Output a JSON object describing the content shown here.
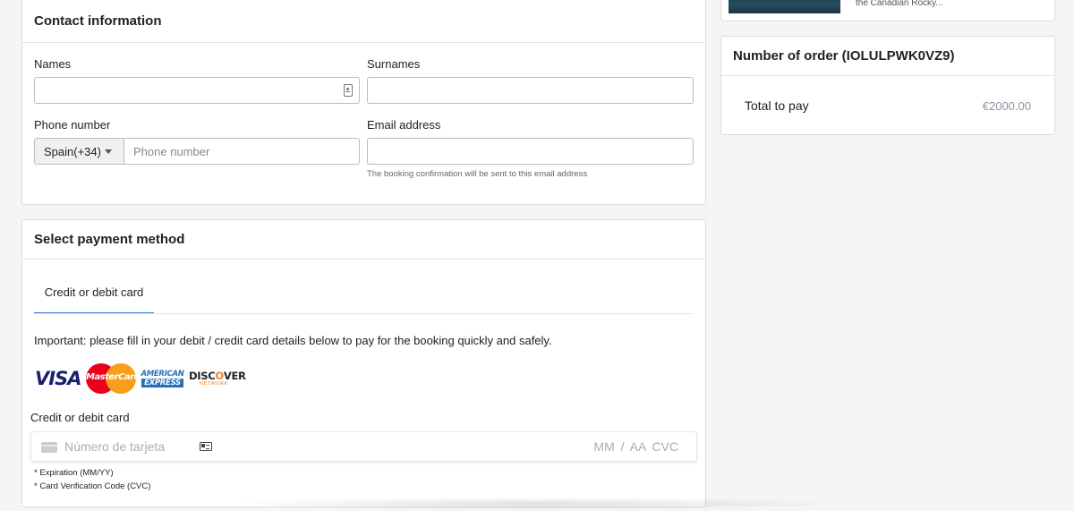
{
  "contact": {
    "title": "Contact information",
    "names_label": "Names",
    "names_value": "",
    "surnames_label": "Surnames",
    "surnames_value": "",
    "phone_label": "Phone number",
    "country_code": "Spain(+34)",
    "phone_placeholder": "Phone number",
    "email_label": "Email address",
    "email_value": "",
    "email_help": "The booking confirmation will be sent to this email address"
  },
  "payment": {
    "title": "Select payment method",
    "tab_label": "Credit or debit card",
    "notice": "Important: please fill in your debit / credit card details below to pay for the booking quickly and safely.",
    "logos": {
      "visa": "VISA",
      "mastercard": "MasterCard",
      "amex_line1": "AMERICAN",
      "amex_line2": "EXPRESS",
      "discover_line1a": "DISC",
      "discover_line1b": "O",
      "discover_line1c": "VER",
      "discover_line2": "NETWORK"
    },
    "card_label": "Credit or debit card",
    "card_number_placeholder": "Número de tarjeta",
    "expiry_cvc_placeholder": "MM / AA  CVC",
    "footnote_1": "* Expiration (MM/YY)",
    "footnote_2": "* Card Verification Code (CVC)"
  },
  "trip": {
    "text": "the Canadian Rocky..."
  },
  "order": {
    "title": "Number of order (IOLULPWK0VZ9)",
    "total_label": "Total to pay",
    "total_value": "€2000.00"
  },
  "colors": {
    "accent": "#2b7bd6",
    "muted_price": "#8d95a0"
  }
}
